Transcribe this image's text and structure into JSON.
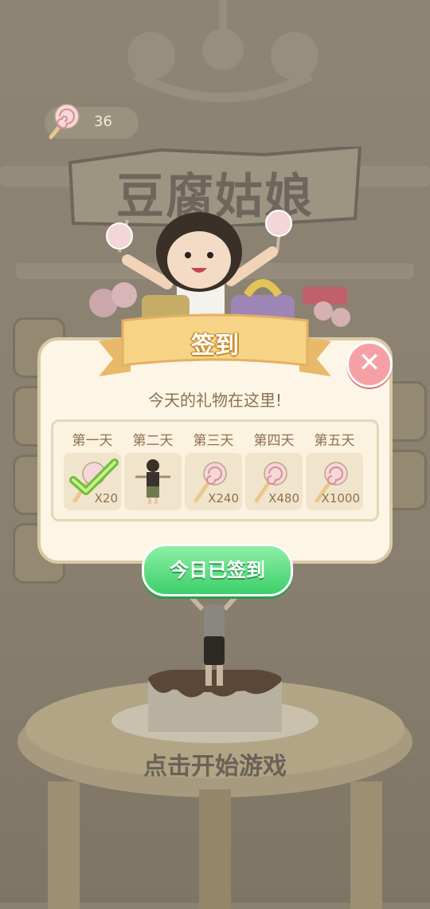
{
  "hud": {
    "candy_count": "36",
    "candy_icon": "lollipop-icon"
  },
  "game": {
    "title": "豆腐姑娘",
    "start_prompt": "点击开始游戏"
  },
  "checkin_dialog": {
    "header": "签到",
    "subtitle": "今天的礼物在这里!",
    "close_icon": "close-icon",
    "days": [
      {
        "label": "第一天",
        "reward_icon": "lollipop-icon",
        "amount": "X20",
        "claimed": true
      },
      {
        "label": "第二天",
        "reward_icon": "character-outfit-icon",
        "amount": "",
        "claimed": false
      },
      {
        "label": "第三天",
        "reward_icon": "lollipop-icon",
        "amount": "X240",
        "claimed": false
      },
      {
        "label": "第四天",
        "reward_icon": "lollipop-icon",
        "amount": "X480",
        "claimed": false
      },
      {
        "label": "第五天",
        "reward_icon": "lollipop-icon",
        "amount": "X1000",
        "claimed": false
      }
    ],
    "confirm_button": "今日已签到"
  },
  "colors": {
    "panel_bg": "#fdf6e6",
    "ribbon": "#f7d386",
    "button_green": "#3ccf6a",
    "close_pink": "#f6a0a5"
  }
}
